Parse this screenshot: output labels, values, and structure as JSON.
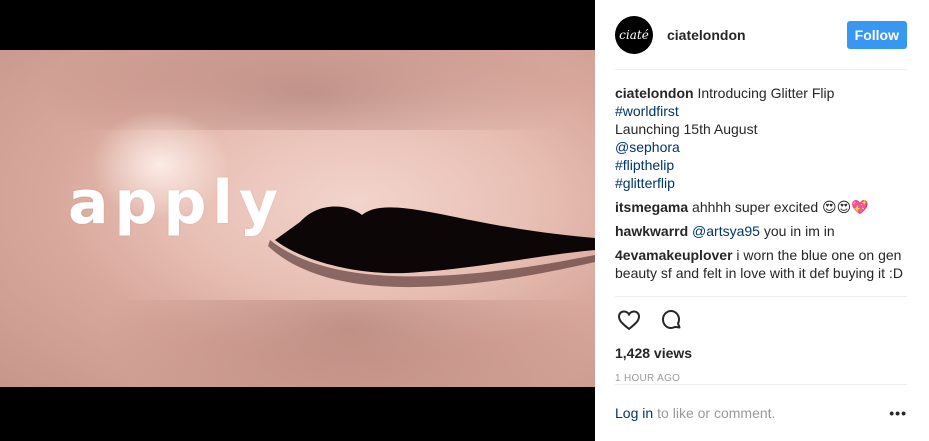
{
  "media": {
    "overlay_text": "apply"
  },
  "header": {
    "avatar_text": "ciaté",
    "avatar_subtext": "LONDON",
    "username": "ciatelondon",
    "follow_label": "Follow"
  },
  "caption": {
    "username": "ciatelondon",
    "lines": [
      {
        "text": "Introducing Glitter Flip",
        "type": "text"
      },
      {
        "text": "#worldfirst",
        "type": "link"
      },
      {
        "text": "Launching 15th August",
        "type": "text"
      },
      {
        "text": "@sephora",
        "type": "link"
      },
      {
        "text": "#flipthelip",
        "type": "link"
      },
      {
        "text": "#glitterflip",
        "type": "link"
      }
    ]
  },
  "comments": [
    {
      "username": "itsmegama",
      "text": "ahhhh super excited 😍😍💖"
    },
    {
      "username": "hawkwarrd",
      "mention": "@artsya95",
      "text": "you in im in"
    },
    {
      "username": "4evamakeuplover",
      "text": "i worn the blue one on gen beauty sf and felt in love with it def buying it :D"
    }
  ],
  "actions": {
    "like_icon": "heart-icon",
    "comment_icon": "comment-bubble-icon"
  },
  "stats": {
    "views": "1,428 views",
    "time": "1 HOUR AGO"
  },
  "footer": {
    "login_label": "Log in",
    "prompt": "to like or comment.",
    "more_label": "•••"
  },
  "colors": {
    "accent": "#3897f0",
    "link": "#003569",
    "muted": "#999999",
    "text": "#262626"
  }
}
